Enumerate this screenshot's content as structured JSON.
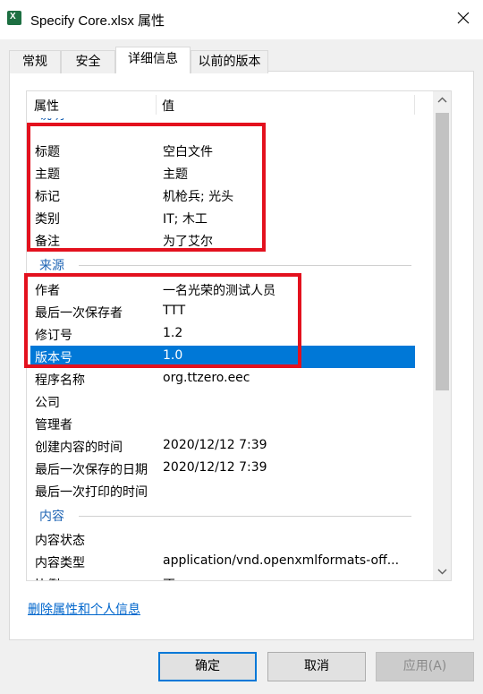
{
  "window": {
    "title": "Specify Core.xlsx 属性"
  },
  "icons": {
    "app": "excel-file-icon",
    "close": "close-icon",
    "up": "scroll-up-arrow-icon",
    "down": "scroll-down-arrow-icon"
  },
  "tabs": [
    {
      "label": "常规"
    },
    {
      "label": "安全"
    },
    {
      "label": "详细信息"
    },
    {
      "label": "以前的版本"
    }
  ],
  "list": {
    "header": {
      "property": "属性",
      "value": "值"
    },
    "groups": {
      "description_partial": "说明",
      "origin": "来源",
      "content": "内容"
    },
    "description_rows": [
      {
        "key": "标题",
        "value": "空白文件"
      },
      {
        "key": "主题",
        "value": "主题"
      },
      {
        "key": "标记",
        "value": "机枪兵; 光头"
      },
      {
        "key": "类别",
        "value": "IT; 木工"
      },
      {
        "key": "备注",
        "value": "为了艾尔"
      }
    ],
    "origin_rows": [
      {
        "key": "作者",
        "value": "一名光荣的测试人员"
      },
      {
        "key": "最后一次保存者",
        "value": "TTT"
      },
      {
        "key": "修订号",
        "value": "1.2"
      },
      {
        "key": "版本号",
        "value": "1.0"
      },
      {
        "key": "程序名称",
        "value": "org.ttzero.eec"
      },
      {
        "key": "公司",
        "value": ""
      },
      {
        "key": "管理者",
        "value": ""
      },
      {
        "key": "创建内容的时间",
        "value": "2020/12/12 7:39"
      },
      {
        "key": "最后一次保存的日期",
        "value": "2020/12/12 7:39"
      },
      {
        "key": "最后一次打印的时间",
        "value": ""
      }
    ],
    "content_rows": [
      {
        "key": "内容状态",
        "value": ""
      },
      {
        "key": "内容类型",
        "value": "application/vnd.openxmlformats-off..."
      },
      {
        "key": "比例",
        "value": "否"
      }
    ]
  },
  "link": {
    "remove": "删除属性和个人信息"
  },
  "buttons": {
    "ok": "确定",
    "cancel": "取消",
    "apply": "应用(A)"
  },
  "colors": {
    "selection": "#0078d7",
    "highlight": "#e3111e",
    "group_label": "#1e64b4",
    "link": "#0066cc"
  }
}
